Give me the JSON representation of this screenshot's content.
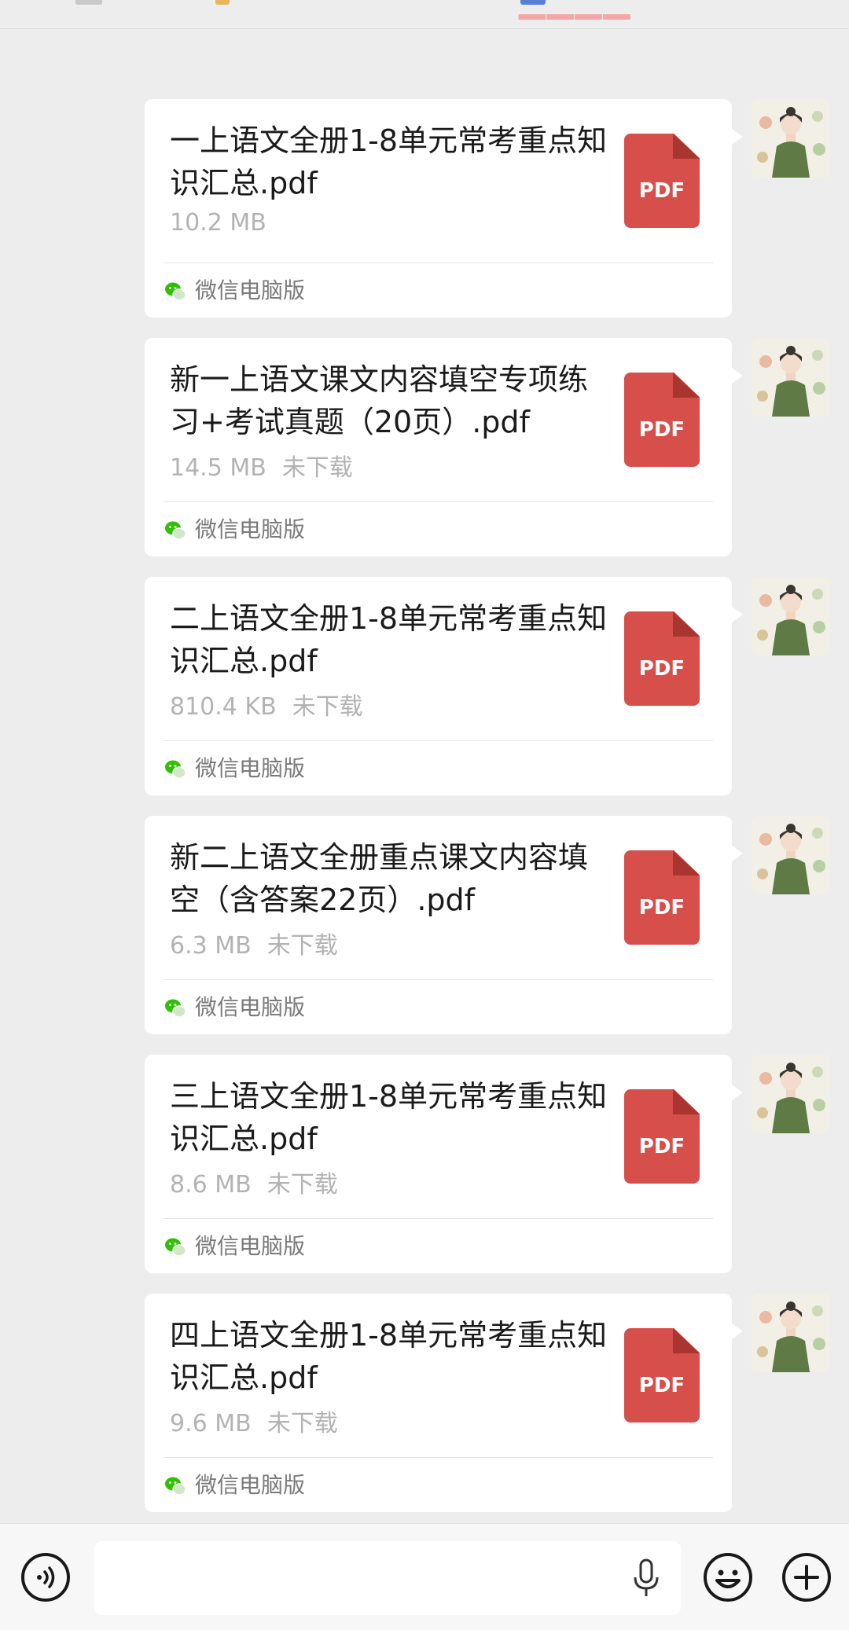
{
  "messages": [
    {
      "filename": "一上语文全册1-8单元常考重点知识汇总.pdf",
      "size": "10.2 MB",
      "status": "",
      "file_type": "PDF",
      "source": "微信电脑版"
    },
    {
      "filename": "新一上语文课文内容填空专项练习+考试真题（20页）.pdf",
      "size": "14.5 MB",
      "status": "未下载",
      "file_type": "PDF",
      "source": "微信电脑版"
    },
    {
      "filename": "二上语文全册1-8单元常考重点知识汇总.pdf",
      "size": "810.4 KB",
      "status": "未下载",
      "file_type": "PDF",
      "source": "微信电脑版"
    },
    {
      "filename": "新二上语文全册重点课文内容填空（含答案22页）.pdf",
      "size": "6.3 MB",
      "status": "未下载",
      "file_type": "PDF",
      "source": "微信电脑版"
    },
    {
      "filename": "三上语文全册1-8单元常考重点知识汇总.pdf",
      "size": "8.6 MB",
      "status": "未下载",
      "file_type": "PDF",
      "source": "微信电脑版"
    },
    {
      "filename": "四上语文全册1-8单元常考重点知识汇总.pdf",
      "size": "9.6 MB",
      "status": "未下载",
      "file_type": "PDF",
      "source": "微信电脑版"
    }
  ],
  "icons": {
    "voice": "voice-toggle-icon",
    "mic": "microphone-icon",
    "emoji": "emoji-icon",
    "plus": "plus-icon",
    "pdf": "pdf-file-icon",
    "wechat": "wechat-icon",
    "avatar": "avatar"
  },
  "colors": {
    "pdf_red": "#d64f4a",
    "wechat_green": "#2dc100",
    "bubble": "#ffffff",
    "background": "#ededed"
  }
}
